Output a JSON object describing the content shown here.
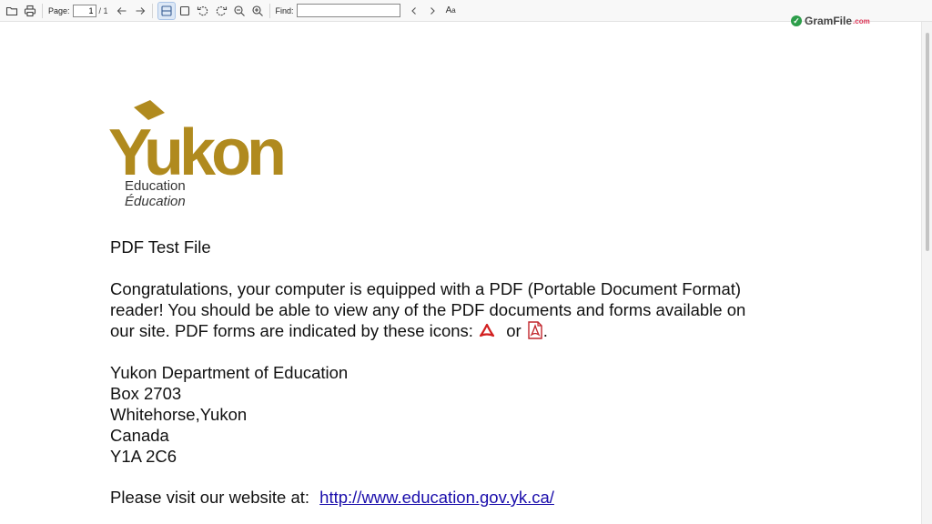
{
  "toolbar": {
    "page_label": "Page:",
    "page_value": "1",
    "page_total": "/ 1",
    "find_label": "Find:",
    "find_value": "",
    "text_size_label": "A",
    "text_size_small": "a"
  },
  "brand": {
    "name": "GramFile",
    "suffix": ".com"
  },
  "document": {
    "logo_text": "Yukon",
    "logo_sub_en": "Education",
    "logo_sub_fr": "Éducation",
    "logo_color": "#b08a1e",
    "title": "PDF Test File",
    "paragraph_line1": "Congratulations, your computer is equipped with a PDF (Portable Document Format)",
    "paragraph_line2": "reader!  You should be able to view any of the PDF documents and forms available on",
    "paragraph_line3_prefix": "our site.  PDF forms are indicated by these icons:",
    "paragraph_or": "or",
    "paragraph_end": ".",
    "address": [
      "Yukon Department of Education",
      "Box 2703",
      "Whitehorse,Yukon",
      "Canada",
      "Y1A 2C6"
    ],
    "website_prefix": "Please visit our website at:",
    "website_link": "http://www.education.gov.yk.ca/"
  }
}
